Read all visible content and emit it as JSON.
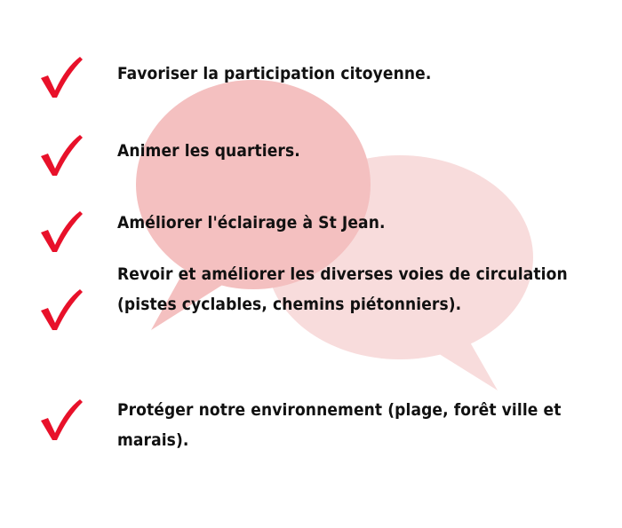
{
  "colors": {
    "check": "#e8112a",
    "bubble_back": "#f8dcdc",
    "bubble_front": "#f4c0c0",
    "text": "#111111"
  },
  "icons": {
    "check": "checkmark-icon",
    "decoration": "speech-bubbles-icon"
  },
  "items": [
    {
      "text": "Favoriser la participation citoyenne."
    },
    {
      "text": "Animer les quartiers."
    },
    {
      "text": "Améliorer l'éclairage à St Jean."
    },
    {
      "text": "Revoir et améliorer les diverses voies de circulation (pistes cyclables, chemins piétonniers)."
    },
    {
      "text": "Protéger notre environnement (plage, forêt ville et marais)."
    }
  ]
}
